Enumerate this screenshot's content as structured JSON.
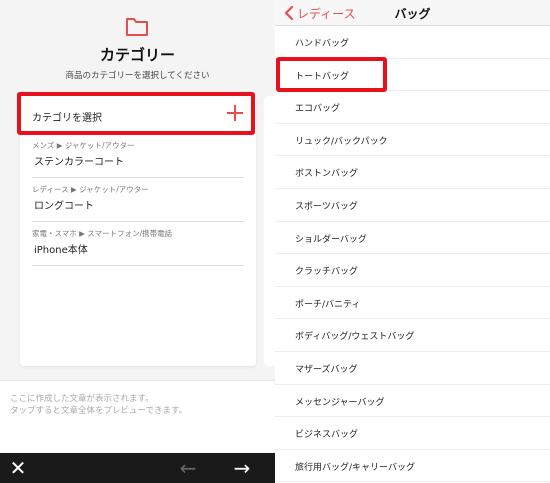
{
  "left": {
    "title": "カテゴリー",
    "subtitle": "商品のカテゴリーを選択してください",
    "select_label": "カテゴリを選択",
    "recent": [
      {
        "path": "メンズ ▶ ジャケット/アウター",
        "name": "ステンカラーコート"
      },
      {
        "path": "レディース ▶ ジャケット/アウター",
        "name": "ロングコート"
      },
      {
        "path": "家電・スマホ ▶ スマートフォン/携帯電話",
        "name": "iPhone本体"
      }
    ],
    "preview_text": "ここに作成した文章が表示されます。\nタップすると文章全体をプレビューできます。",
    "bottom_bar": {
      "close": "✕",
      "back": "←",
      "forward": "→"
    }
  },
  "right": {
    "nav": {
      "back_label": "レディース",
      "title": "バッグ"
    },
    "items": [
      "ハンドバッグ",
      "トートバッグ",
      "エコバッグ",
      "リュック/バックパック",
      "ボストンバッグ",
      "スポーツバッグ",
      "ショルダーバッグ",
      "クラッチバッグ",
      "ポーチ/バニティ",
      "ボディバッグ/ウェストバッグ",
      "マザーズバッグ",
      "メッセンジャーバッグ",
      "ビジネスバッグ",
      "旅行用バッグ/キャリーバッグ"
    ]
  },
  "colors": {
    "accent": "#e84c4c",
    "highlight": "#e8101c",
    "bar": "#1a1a1a"
  },
  "icons": {
    "folder": "folder-icon",
    "plus": "plus-icon",
    "close": "close-icon",
    "back": "back-arrow-icon",
    "forward": "forward-arrow-icon",
    "chevron": "chevron-left-icon"
  }
}
